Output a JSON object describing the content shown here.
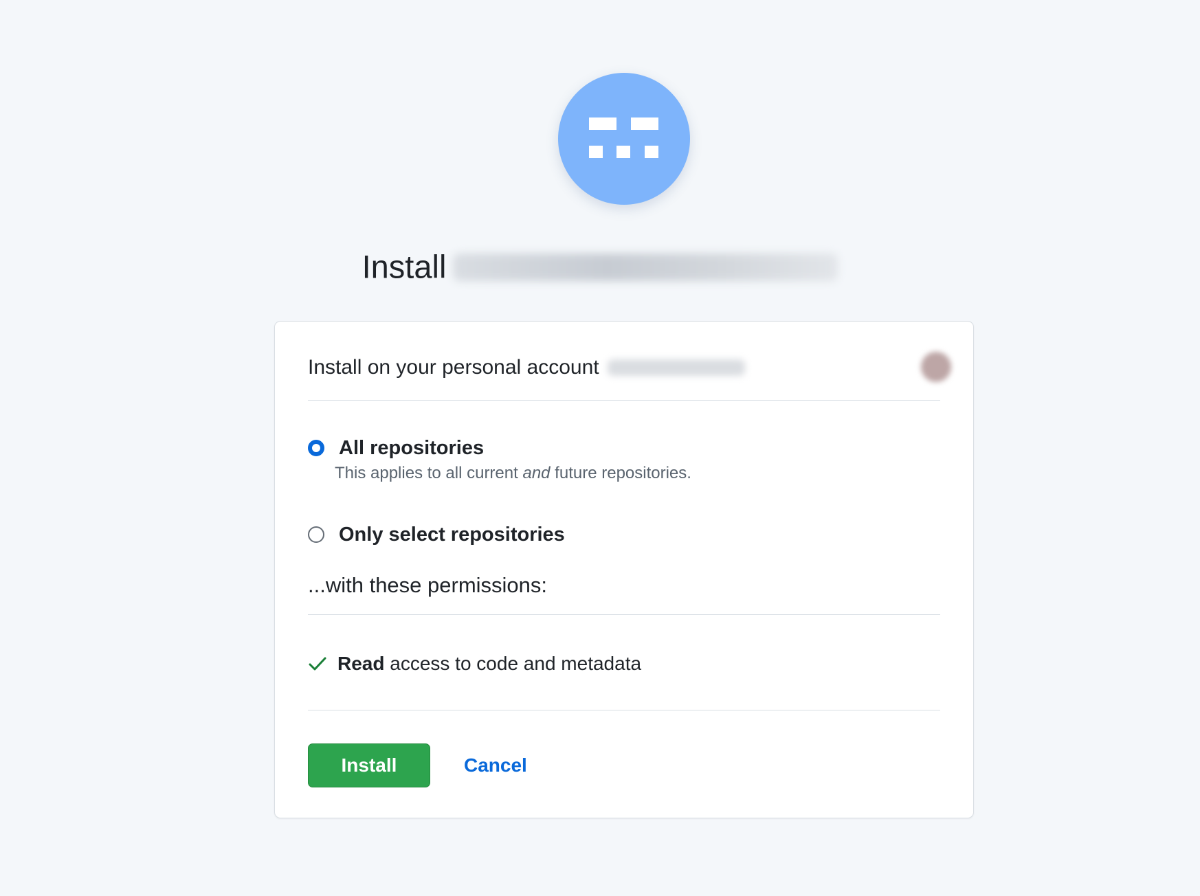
{
  "header": {
    "title_prefix": "Install"
  },
  "install_card": {
    "account_label": "Install on your personal account",
    "repo_options": [
      {
        "label": "All repositories",
        "description_before": "This applies to all current ",
        "description_emphasis": "and",
        "description_after": " future repositories.",
        "selected": true
      },
      {
        "label": "Only select repositories",
        "selected": false
      }
    ],
    "permissions_heading": "...with these permissions:",
    "permissions": [
      {
        "access": "Read",
        "scope": " access to code and metadata",
        "icon": "check-icon"
      }
    ],
    "install_label": "Install",
    "cancel_label": "Cancel"
  },
  "colors": {
    "page_background": "#f4f7fa",
    "logo_background": "#7eb4fb",
    "primary_button": "#2da44e",
    "link": "#0969da",
    "radio_selected": "#0969da",
    "check": "#1a7f37"
  }
}
